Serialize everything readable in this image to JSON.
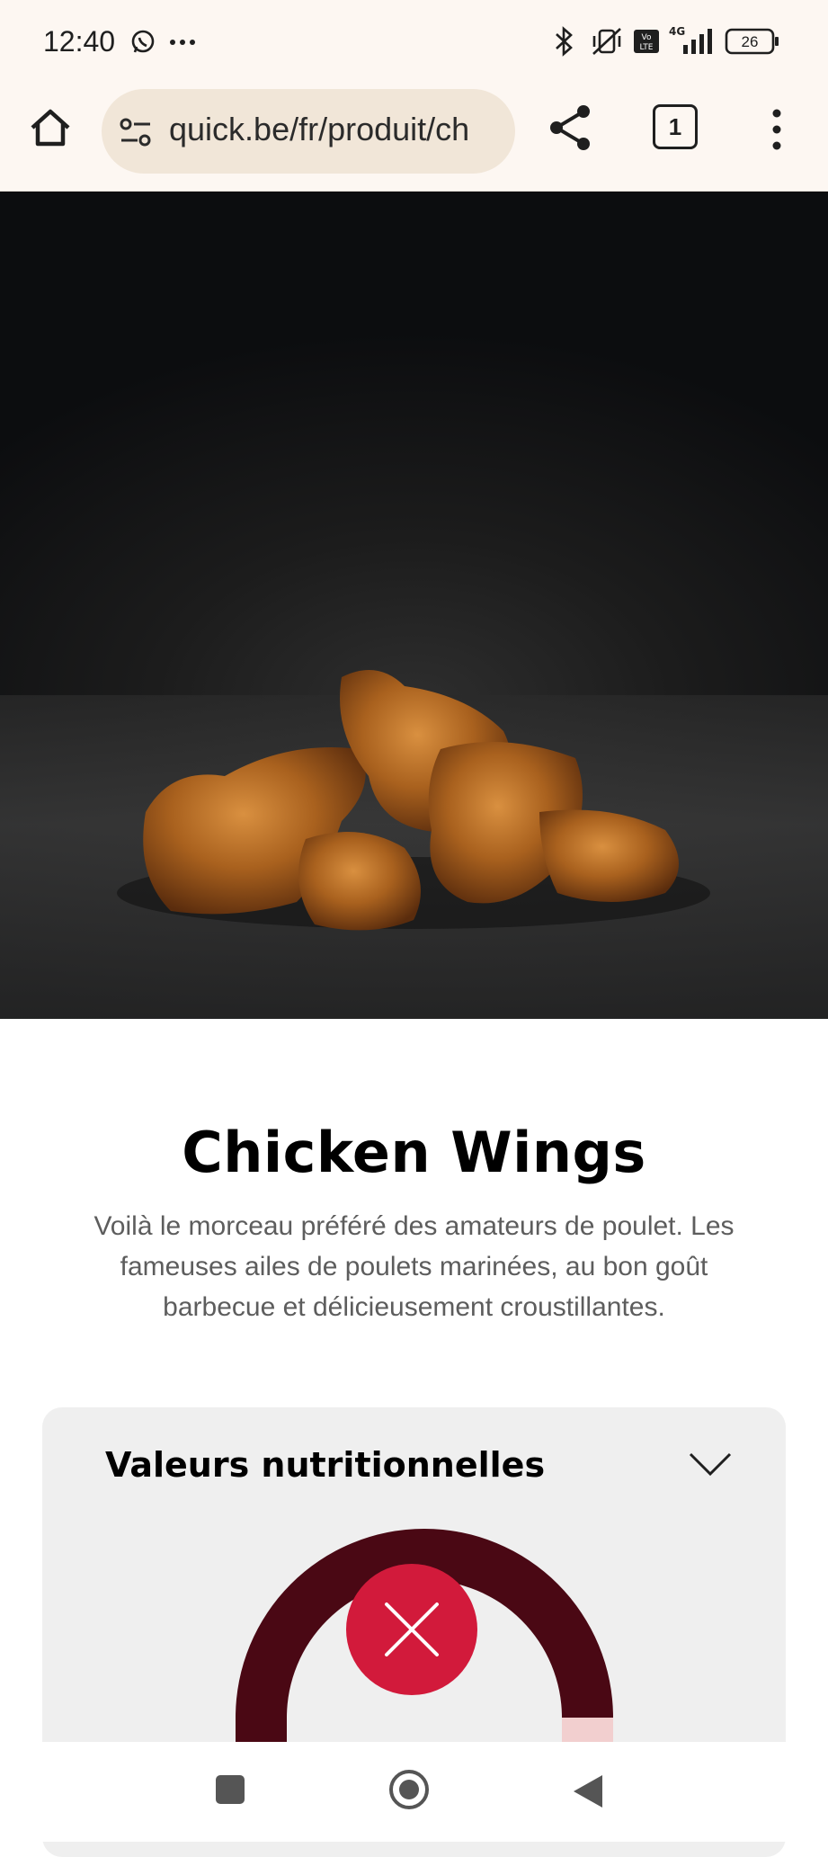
{
  "status_bar": {
    "time": "12:40",
    "battery": "26",
    "network": "4G",
    "icons": [
      "whatsapp-icon",
      "more-dots-icon",
      "bluetooth-icon",
      "vibrate-off-icon",
      "volte-icon",
      "signal-icon",
      "battery-icon"
    ]
  },
  "browser": {
    "url": "quick.be/fr/produit/ch",
    "tab_count": "1",
    "icons": [
      "home-icon",
      "site-settings-icon",
      "share-icon",
      "tabs-icon",
      "menu-icon"
    ]
  },
  "product": {
    "title": "Chicken Wings",
    "description": "Voilà le morceau préféré des amateurs de poulet. Les fameuses ailes de poulets marinées, au bon goût barbecue et délicieusement croustillantes."
  },
  "nutrition": {
    "title": "Valeurs nutritionnelles",
    "colors": {
      "gauge_main": "#4a0814",
      "gauge_light": "#f2cfcf",
      "close_button": "#d21a3b"
    }
  },
  "navigation": {
    "icons": [
      "recents-icon",
      "home-circle-icon",
      "back-icon"
    ]
  }
}
